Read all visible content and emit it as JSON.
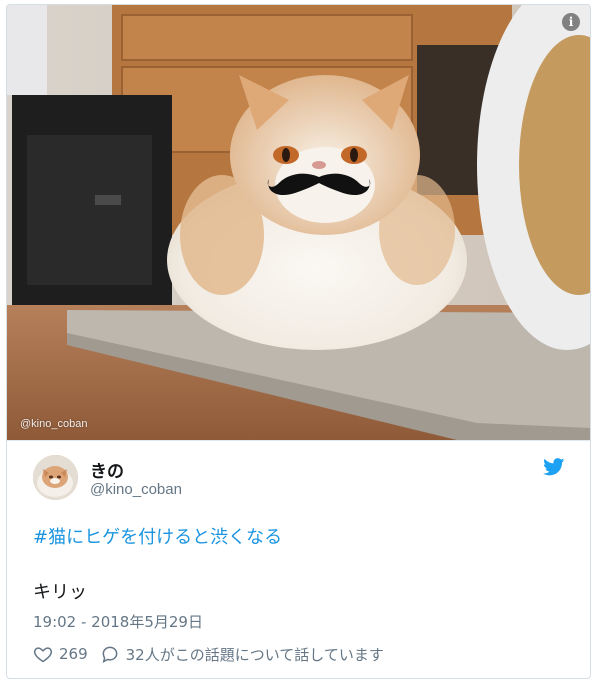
{
  "tweet": {
    "photo_watermark": "@kino_coban",
    "author": {
      "name": "きの",
      "handle": "@kino_coban"
    },
    "hashtag": "#猫にヒゲを付けると渋くなる",
    "text": "キリッ",
    "timestamp": "19:02 - 2018年5月29日",
    "likes": "269",
    "replies": "32人がこの話題について話しています",
    "colors": {
      "link": "#1b95e0",
      "twitter_blue": "#1da1f2",
      "secondary": "#657786"
    },
    "icons": [
      "info-icon",
      "twitter-bird-icon",
      "heart-icon",
      "reply-icon"
    ]
  }
}
